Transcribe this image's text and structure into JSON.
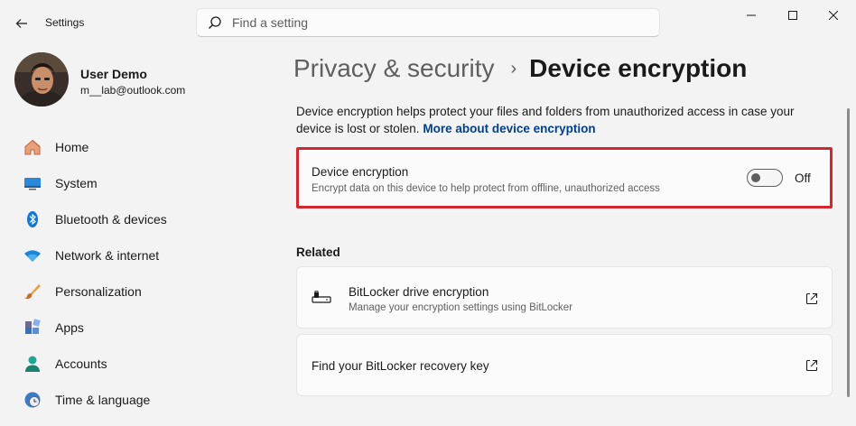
{
  "app": {
    "title": "Settings"
  },
  "search": {
    "placeholder": "Find a setting"
  },
  "user": {
    "name": "User Demo",
    "email": "m__lab@outlook.com"
  },
  "nav": {
    "items": [
      {
        "label": "Home",
        "icon": "home-icon"
      },
      {
        "label": "System",
        "icon": "system-monitor-icon"
      },
      {
        "label": "Bluetooth & devices",
        "icon": "bluetooth-icon"
      },
      {
        "label": "Network & internet",
        "icon": "wifi-icon"
      },
      {
        "label": "Personalization",
        "icon": "brush-icon"
      },
      {
        "label": "Apps",
        "icon": "apps-icon"
      },
      {
        "label": "Accounts",
        "icon": "account-icon"
      },
      {
        "label": "Time & language",
        "icon": "clock-globe-icon"
      }
    ]
  },
  "breadcrumb": {
    "parent": "Privacy & security",
    "separator": "›",
    "current": "Device encryption"
  },
  "description": {
    "text": "Device encryption helps protect your files and folders from unauthorized access in case your device is lost or stolen.",
    "link": "More about device encryption"
  },
  "encryption_card": {
    "title": "Device encryption",
    "subtitle": "Encrypt data on this device to help protect from offline, unauthorized access",
    "toggle_state": "Off",
    "toggle_on": false
  },
  "related": {
    "heading": "Related",
    "items": [
      {
        "title": "BitLocker drive encryption",
        "subtitle": "Manage your encryption settings using BitLocker",
        "icon": "bitlocker-drive-icon",
        "action_icon": "open-external-icon"
      },
      {
        "title": "Find your BitLocker recovery key",
        "action_icon": "open-external-icon"
      }
    ]
  },
  "colors": {
    "highlight_border": "#d12730",
    "link": "#003e92",
    "accent": "#0067c0"
  }
}
